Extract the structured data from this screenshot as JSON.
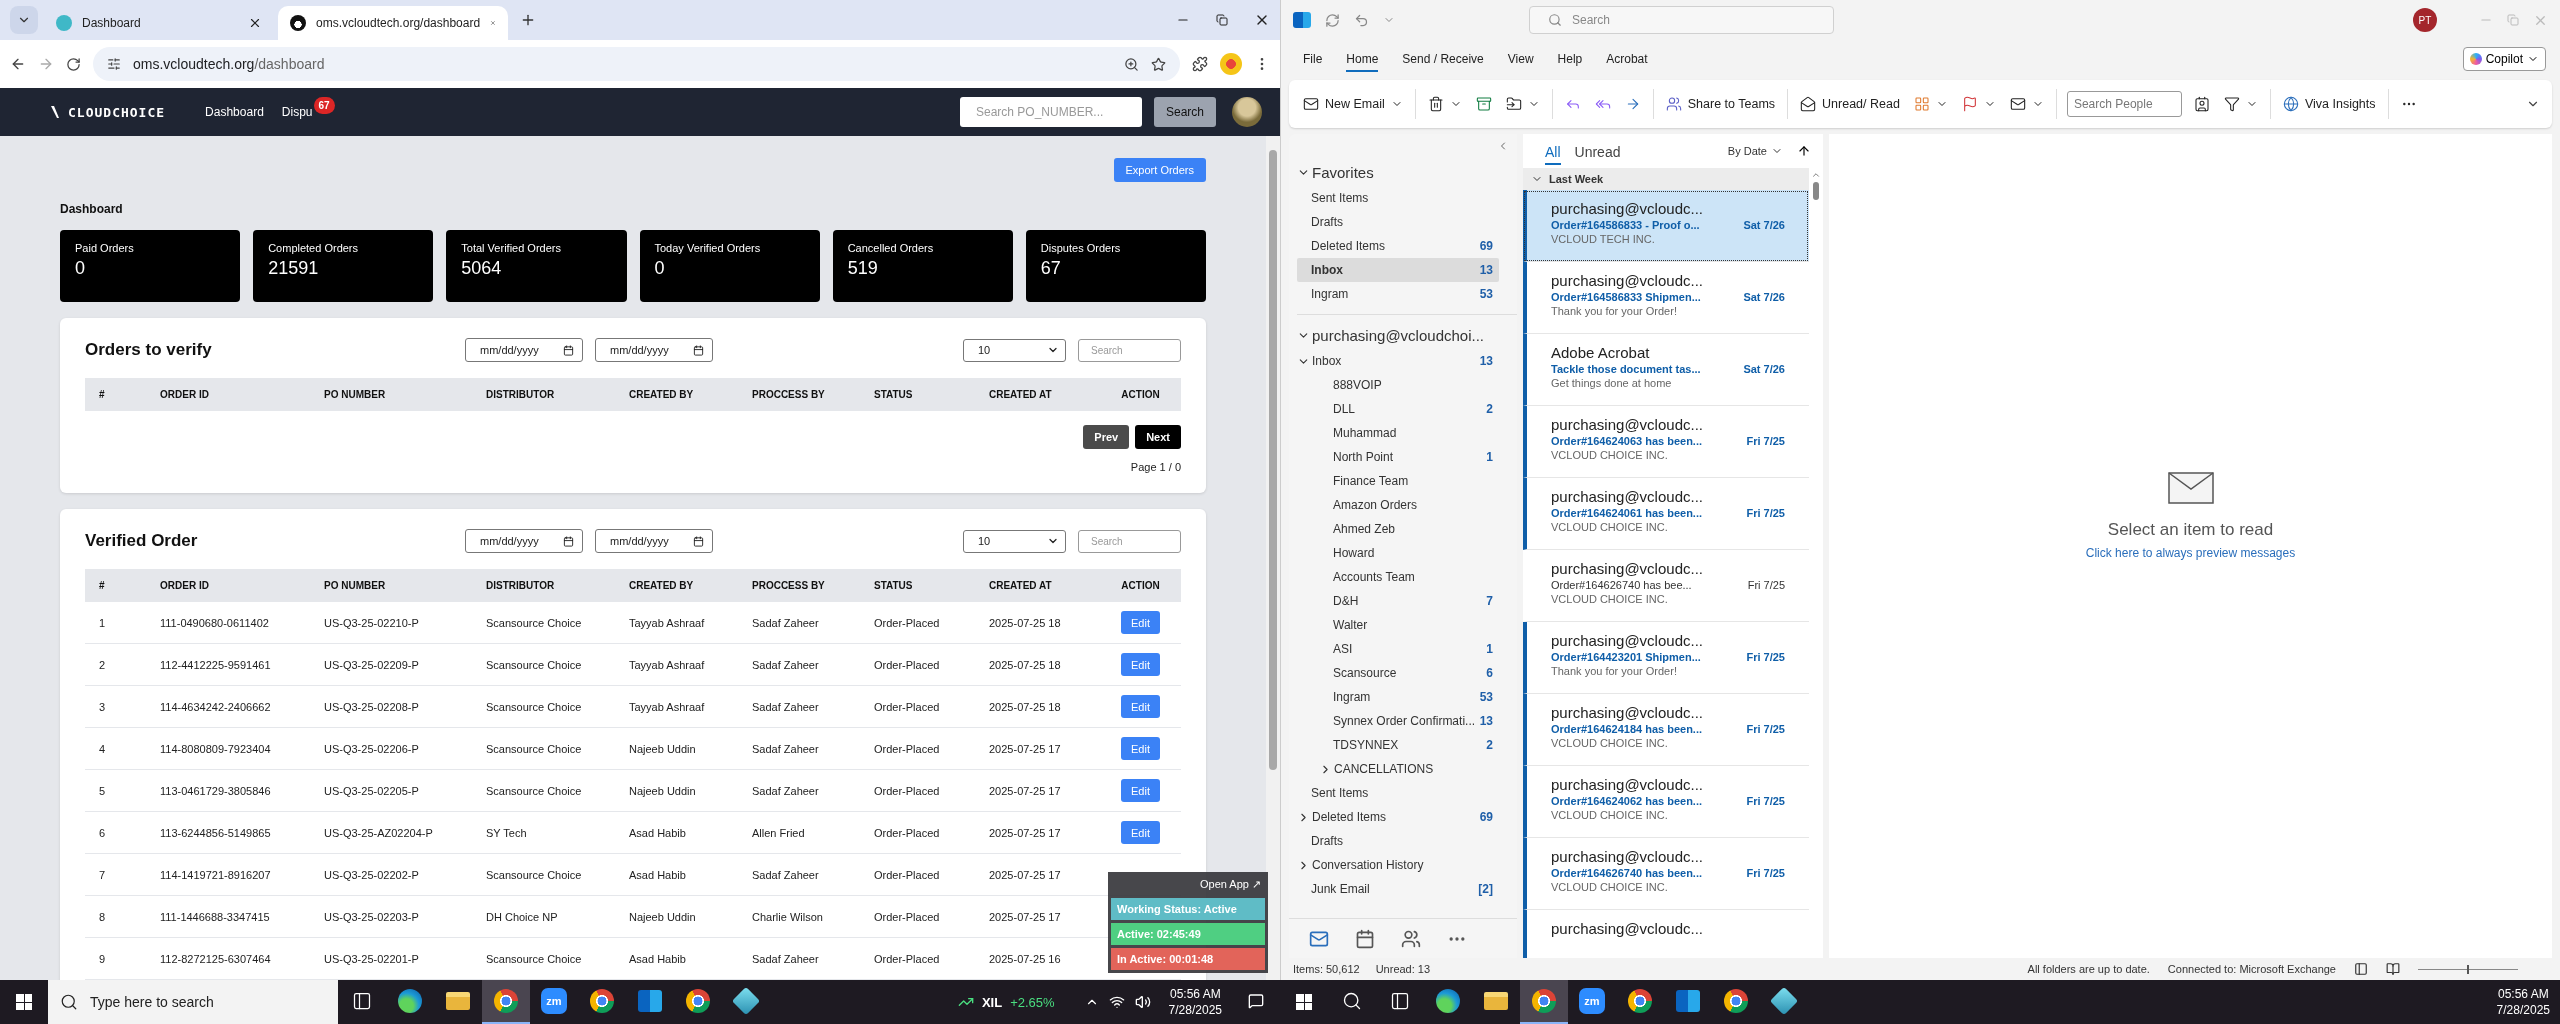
{
  "browser": {
    "tabs": [
      {
        "title": "Dashboard",
        "selected": false
      },
      {
        "title": "oms.vcloudtech.org/dashboard",
        "selected": true
      }
    ],
    "address": {
      "host": "oms.vcloudtech.org",
      "path": "/dashboard"
    },
    "site": {
      "logo": "CLOUDCHOICE",
      "nav": [
        {
          "label": "Dashboard"
        },
        {
          "label": "Dispu",
          "badge": "67"
        }
      ],
      "search": {
        "placeholder": "Search PO_NUMBER...",
        "button": "Search"
      },
      "export_button": "Export Orders",
      "heading": "Dashboard",
      "stats": [
        {
          "label": "Paid Orders",
          "value": "0"
        },
        {
          "label": "Completed Orders",
          "value": "21591"
        },
        {
          "label": "Total Verified Orders",
          "value": "5064"
        },
        {
          "label": "Today Verified Orders",
          "value": "0"
        },
        {
          "label": "Cancelled Orders",
          "value": "519"
        },
        {
          "label": "Disputes Orders",
          "value": "67"
        }
      ],
      "tables": [
        {
          "title": "Orders to verify",
          "date_placeholders": [
            "mm/dd/yyyy",
            "mm/dd/yyyy"
          ],
          "page_size": "10",
          "search_placeholder": "Search",
          "columns": [
            "#",
            "ORDER ID",
            "PO NUMBER",
            "DISTRIBUTOR",
            "CREATED BY",
            "PROCCESS BY",
            "STATUS",
            "CREATED AT",
            "ACTION"
          ],
          "pager": {
            "prev": "Prev",
            "next": "Next",
            "page": "Page 1 / 0"
          }
        },
        {
          "title": "Verified Order",
          "date_placeholders": [
            "mm/dd/yyyy",
            "mm/dd/yyyy"
          ],
          "page_size": "10",
          "search_placeholder": "Search",
          "columns": [
            "#",
            "ORDER ID",
            "PO NUMBER",
            "DISTRIBUTOR",
            "CREATED BY",
            "PROCCESS BY",
            "STATUS",
            "CREATED AT",
            "ACTION"
          ],
          "rows": [
            {
              "cells": [
                "1",
                "111-0490680-0611402",
                "US-Q3-25-02210-P",
                "Scansource Choice",
                "Tayyab Ashraaf",
                "Sadaf Zaheer",
                "Order-Placed",
                "2025-07-25 18"
              ],
              "action": "Edit"
            },
            {
              "cells": [
                "2",
                "112-4412225-9591461",
                "US-Q3-25-02209-P",
                "Scansource Choice",
                "Tayyab Ashraaf",
                "Sadaf Zaheer",
                "Order-Placed",
                "2025-07-25 18"
              ],
              "action": "Edit"
            },
            {
              "cells": [
                "3",
                "114-4634242-2406662",
                "US-Q3-25-02208-P",
                "Scansource Choice",
                "Tayyab Ashraaf",
                "Sadaf Zaheer",
                "Order-Placed",
                "2025-07-25 18"
              ],
              "action": "Edit"
            },
            {
              "cells": [
                "4",
                "114-8080809-7923404",
                "US-Q3-25-02206-P",
                "Scansource Choice",
                "Najeeb Uddin",
                "Sadaf Zaheer",
                "Order-Placed",
                "2025-07-25 17"
              ],
              "action": "Edit"
            },
            {
              "cells": [
                "5",
                "113-0461729-3805846",
                "US-Q3-25-02205-P",
                "Scansource Choice",
                "Najeeb Uddin",
                "Sadaf Zaheer",
                "Order-Placed",
                "2025-07-25 17"
              ],
              "action": "Edit"
            },
            {
              "cells": [
                "6",
                "113-6244856-5149865",
                "US-Q3-25-AZ02204-P",
                "SY Tech",
                "Asad Habib",
                "Allen Fried",
                "Order-Placed",
                "2025-07-25 17"
              ],
              "action": "Edit"
            },
            {
              "cells": [
                "7",
                "114-1419721-8916207",
                "US-Q3-25-02202-P",
                "Scansource Choice",
                "Asad Habib",
                "Sadaf Zaheer",
                "Order-Placed",
                "2025-07-25 17"
              ]
            },
            {
              "cells": [
                "8",
                "111-1446688-3347415",
                "US-Q3-25-02203-P",
                "DH Choice NP",
                "Najeeb Uddin",
                "Charlie Wilson",
                "Order-Placed",
                "2025-07-25 17"
              ]
            },
            {
              "cells": [
                "9",
                "112-8272125-6307464",
                "US-Q3-25-02201-P",
                "Scansource Choice",
                "Asad Habib",
                "Sadaf Zaheer",
                "Order-Placed",
                "2025-07-25 16"
              ]
            }
          ]
        }
      ]
    },
    "widget": {
      "open_app": "Open App ↗",
      "status": "Working Status: Active",
      "active": "Active: 02:45:49",
      "inactive": "In Active: 00:01:48"
    }
  },
  "outlook": {
    "search_placeholder": "Search",
    "avatar": "PT",
    "menu": [
      {
        "label": "File",
        "selected": false
      },
      {
        "label": "Home",
        "selected": true
      },
      {
        "label": "Send / Receive",
        "selected": false
      },
      {
        "label": "View",
        "selected": false
      },
      {
        "label": "Help",
        "selected": false
      },
      {
        "label": "Acrobat",
        "selected": false
      }
    ],
    "copilot": "Copilot",
    "ribbon": {
      "new_email": "New Email",
      "share_teams": "Share to Teams",
      "unread_read": "Unread/ Read",
      "search_people_placeholder": "Search People",
      "viva": "Viva Insights"
    },
    "folders": [
      {
        "name": "Favorites",
        "expanded": true,
        "selected": false,
        "children": [
          {
            "name": "Sent Items",
            "selected": false
          },
          {
            "name": "Drafts",
            "selected": false
          },
          {
            "name": "Deleted Items",
            "count": "69",
            "selected": false
          },
          {
            "name": "Inbox",
            "count": "13",
            "selected": true
          },
          {
            "name": "Ingram",
            "count": "53",
            "selected": false
          }
        ]
      },
      {
        "name": "purchasing@vcloudchoi...",
        "expanded": true,
        "selected": false,
        "children": [
          {
            "name": "Inbox",
            "count": "13",
            "expanded": true,
            "selected": false,
            "children": [
              {
                "name": "888VOIP",
                "selected": false
              },
              {
                "name": "DLL",
                "count": "2",
                "selected": false
              },
              {
                "name": "Muhammad",
                "selected": false
              },
              {
                "name": "North Point",
                "count": "1",
                "selected": false
              },
              {
                "name": "Finance Team",
                "selected": false
              },
              {
                "name": "Amazon Orders",
                "selected": false
              },
              {
                "name": "Ahmed Zeb",
                "selected": false
              },
              {
                "name": "Howard",
                "selected": false
              },
              {
                "name": "Accounts Team",
                "selected": false
              },
              {
                "name": "D&H",
                "count": "7",
                "selected": false
              },
              {
                "name": "Walter",
                "selected": false
              },
              {
                "name": "ASI",
                "count": "1",
                "selected": false
              },
              {
                "name": "Scansource",
                "count": "6",
                "selected": false
              },
              {
                "name": "Ingram",
                "count": "53",
                "selected": false
              },
              {
                "name": "Synnex Order Confirmati...",
                "count": "13",
                "selected": false
              },
              {
                "name": "TDSYNNEX",
                "count": "2",
                "selected": false
              },
              {
                "name": "CANCELLATIONS",
                "expanded": false,
                "selected": false
              }
            ]
          },
          {
            "name": "Sent Items",
            "selected": false
          },
          {
            "name": "Deleted Items",
            "count": "69",
            "expanded": false,
            "selected": false
          },
          {
            "name": "Drafts",
            "selected": false
          },
          {
            "name": "Conversation History",
            "expanded": false,
            "selected": false
          },
          {
            "name": "Junk Email",
            "count": "[2]",
            "selected": false
          }
        ]
      }
    ],
    "list_tabs": [
      {
        "label": "All",
        "selected": true
      },
      {
        "label": "Unread",
        "selected": false
      }
    ],
    "sort": "By Date",
    "group": {
      "label": "Last Week",
      "expanded": true
    },
    "messages": [
      {
        "sender": "purchasing@vcloudc...",
        "subject": "Order#164586833 - Proof o...",
        "preview": "VCLOUD TECH INC.",
        "date": "Sat 7/26",
        "unread": true,
        "selected": true
      },
      {
        "sender": "purchasing@vcloudc...",
        "subject": "Order#164586833 Shipmen...",
        "preview": "Thank you for your Order!",
        "date": "Sat 7/26",
        "unread": true,
        "selected": false
      },
      {
        "sender": "Adobe Acrobat",
        "subject": "Tackle those document tas...",
        "preview": "Get things done at home",
        "date": "Sat 7/26",
        "unread": true,
        "selected": false
      },
      {
        "sender": "purchasing@vcloudc...",
        "subject": "Order#164624063 has been...",
        "preview": "VCLOUD CHOICE INC.",
        "date": "Fri 7/25",
        "unread": true,
        "selected": false
      },
      {
        "sender": "purchasing@vcloudc...",
        "subject": "Order#164624061 has been...",
        "preview": "VCLOUD CHOICE INC.",
        "date": "Fri 7/25",
        "unread": true,
        "selected": false
      },
      {
        "sender": "purchasing@vcloudc...",
        "subject": "Order#164626740 has bee...",
        "preview": "VCLOUD CHOICE INC.",
        "date": "Fri 7/25",
        "unread": false,
        "selected": false
      },
      {
        "sender": "purchasing@vcloudc...",
        "subject": "Order#164423201 Shipmen...",
        "preview": "Thank you for your Order!",
        "date": "Fri 7/25",
        "unread": true,
        "selected": false
      },
      {
        "sender": "purchasing@vcloudc...",
        "subject": "Order#164624184 has been...",
        "preview": "VCLOUD CHOICE INC.",
        "date": "Fri 7/25",
        "unread": true,
        "selected": false
      },
      {
        "sender": "purchasing@vcloudc...",
        "subject": "Order#164624062 has been...",
        "preview": "VCLOUD CHOICE INC.",
        "date": "Fri 7/25",
        "unread": true,
        "selected": false
      },
      {
        "sender": "purchasing@vcloudc...",
        "subject": "Order#164626740 has been...",
        "preview": "VCLOUD CHOICE INC.",
        "date": "Fri 7/25",
        "unread": true,
        "selected": false
      },
      {
        "sender": "purchasing@vcloudc...",
        "unread": true,
        "selected": false
      }
    ],
    "reading_pane": {
      "title": "Select an item to read",
      "link": "Click here to always preview messages"
    },
    "status": {
      "items": "Items: 50,612",
      "unread": "Unread: 13",
      "sync": "All folders are up to date.",
      "connection": "Connected to: Microsoft Exchange",
      "zoom": {
        "level": 0.5
      }
    }
  },
  "taskbars": [
    {
      "search": "Type here to search",
      "ticker": {
        "symbol": "XIL",
        "change": "+2.65%"
      },
      "time": "05:56 AM",
      "date": "7/28/2025",
      "apps": [
        {
          "kind": "taskview",
          "active": false
        },
        {
          "kind": "edge",
          "active": false
        },
        {
          "kind": "explorer",
          "active": false
        },
        {
          "kind": "chrome",
          "active": true
        },
        {
          "kind": "zoom",
          "label": "zm",
          "active": false
        },
        {
          "kind": "chrome",
          "active": false
        },
        {
          "kind": "outlook",
          "active": false
        },
        {
          "kind": "chrome",
          "active": false
        },
        {
          "kind": "app",
          "active": false
        }
      ]
    },
    {
      "time": "05:56 AM",
      "date": "7/28/2025",
      "apps": [
        {
          "kind": "taskview",
          "active": false
        },
        {
          "kind": "edge",
          "active": false
        },
        {
          "kind": "explorer",
          "active": false
        },
        {
          "kind": "chrome",
          "active": true
        },
        {
          "kind": "zoom",
          "label": "zm",
          "active": false
        },
        {
          "kind": "chrome",
          "active": false
        },
        {
          "kind": "outlook",
          "active": false
        },
        {
          "kind": "chrome",
          "active": false
        },
        {
          "kind": "app",
          "active": false
        }
      ]
    }
  ]
}
